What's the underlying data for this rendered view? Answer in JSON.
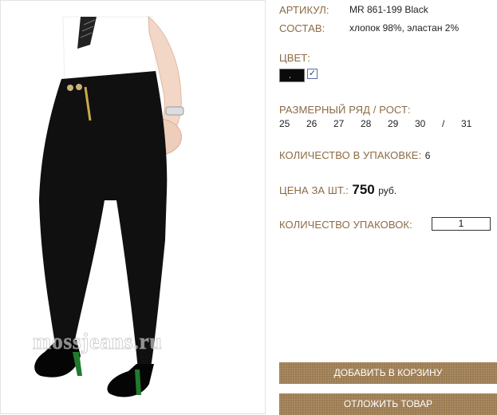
{
  "product": {
    "article_label": "АРТИКУЛ:",
    "article_value": "MR 861-199 Black",
    "composition_label": "СОСТАВ:",
    "composition_value": "хлопок 98%, эластан 2%",
    "color_label": "ЦВЕТ:",
    "color_swatch": "#0b0b0b",
    "color_checked_mark": "✓",
    "size_label": "РАЗМЕРНЫЙ РЯД / РОСТ:",
    "sizes": [
      "25",
      "26",
      "27",
      "28",
      "29",
      "30",
      "/",
      "31"
    ],
    "pack_qty_label": "КОЛИЧЕСТВО В УПАКОВКЕ:",
    "pack_qty_value": "6",
    "price_label": "ЦЕНА ЗА ШТ.:",
    "price_value": "750",
    "price_currency": "руб.",
    "packs_label": "КОЛИЧЕСТВО УПАКОВОК:",
    "packs_value": "1"
  },
  "buttons": {
    "add_to_cart": "ДОБАВИТЬ В КОРЗИНУ",
    "defer_item": "ОТЛОЖИТЬ ТОВАР"
  },
  "photo": {
    "watermark": "mossjeans.ru"
  },
  "colors": {
    "label_brown": "#8b6b45",
    "button_brown": "#9b7a4f"
  }
}
